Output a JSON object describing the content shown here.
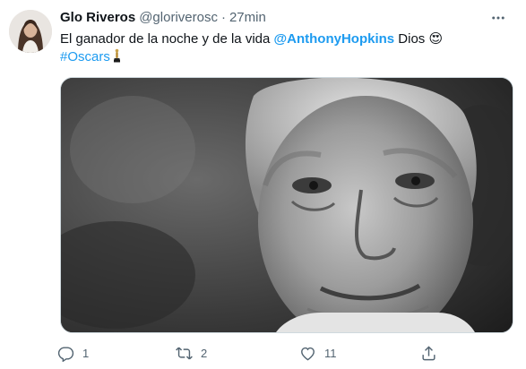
{
  "tweet": {
    "author_name": "Glo Riveros",
    "author_handle": "@gloriverosc",
    "separator": "·",
    "time": "27min",
    "text_part1": "El ganador de la noche y de la vida ",
    "mention": "@AnthonyHopkins",
    "text_part2": " Dios ",
    "emoji_1": "😍",
    "hashtag": "#Oscars",
    "emoji_2": "trophy",
    "media_description": "Black-and-white close-up portrait photo"
  },
  "actions": {
    "reply_count": "1",
    "retweet_count": "2",
    "like_count": "11"
  },
  "icons": [
    "more-icon",
    "reply-icon",
    "retweet-icon",
    "like-icon",
    "share-icon"
  ],
  "colors": {
    "link": "#1d9bf0",
    "text": "#0f1419",
    "muted": "#536471"
  }
}
